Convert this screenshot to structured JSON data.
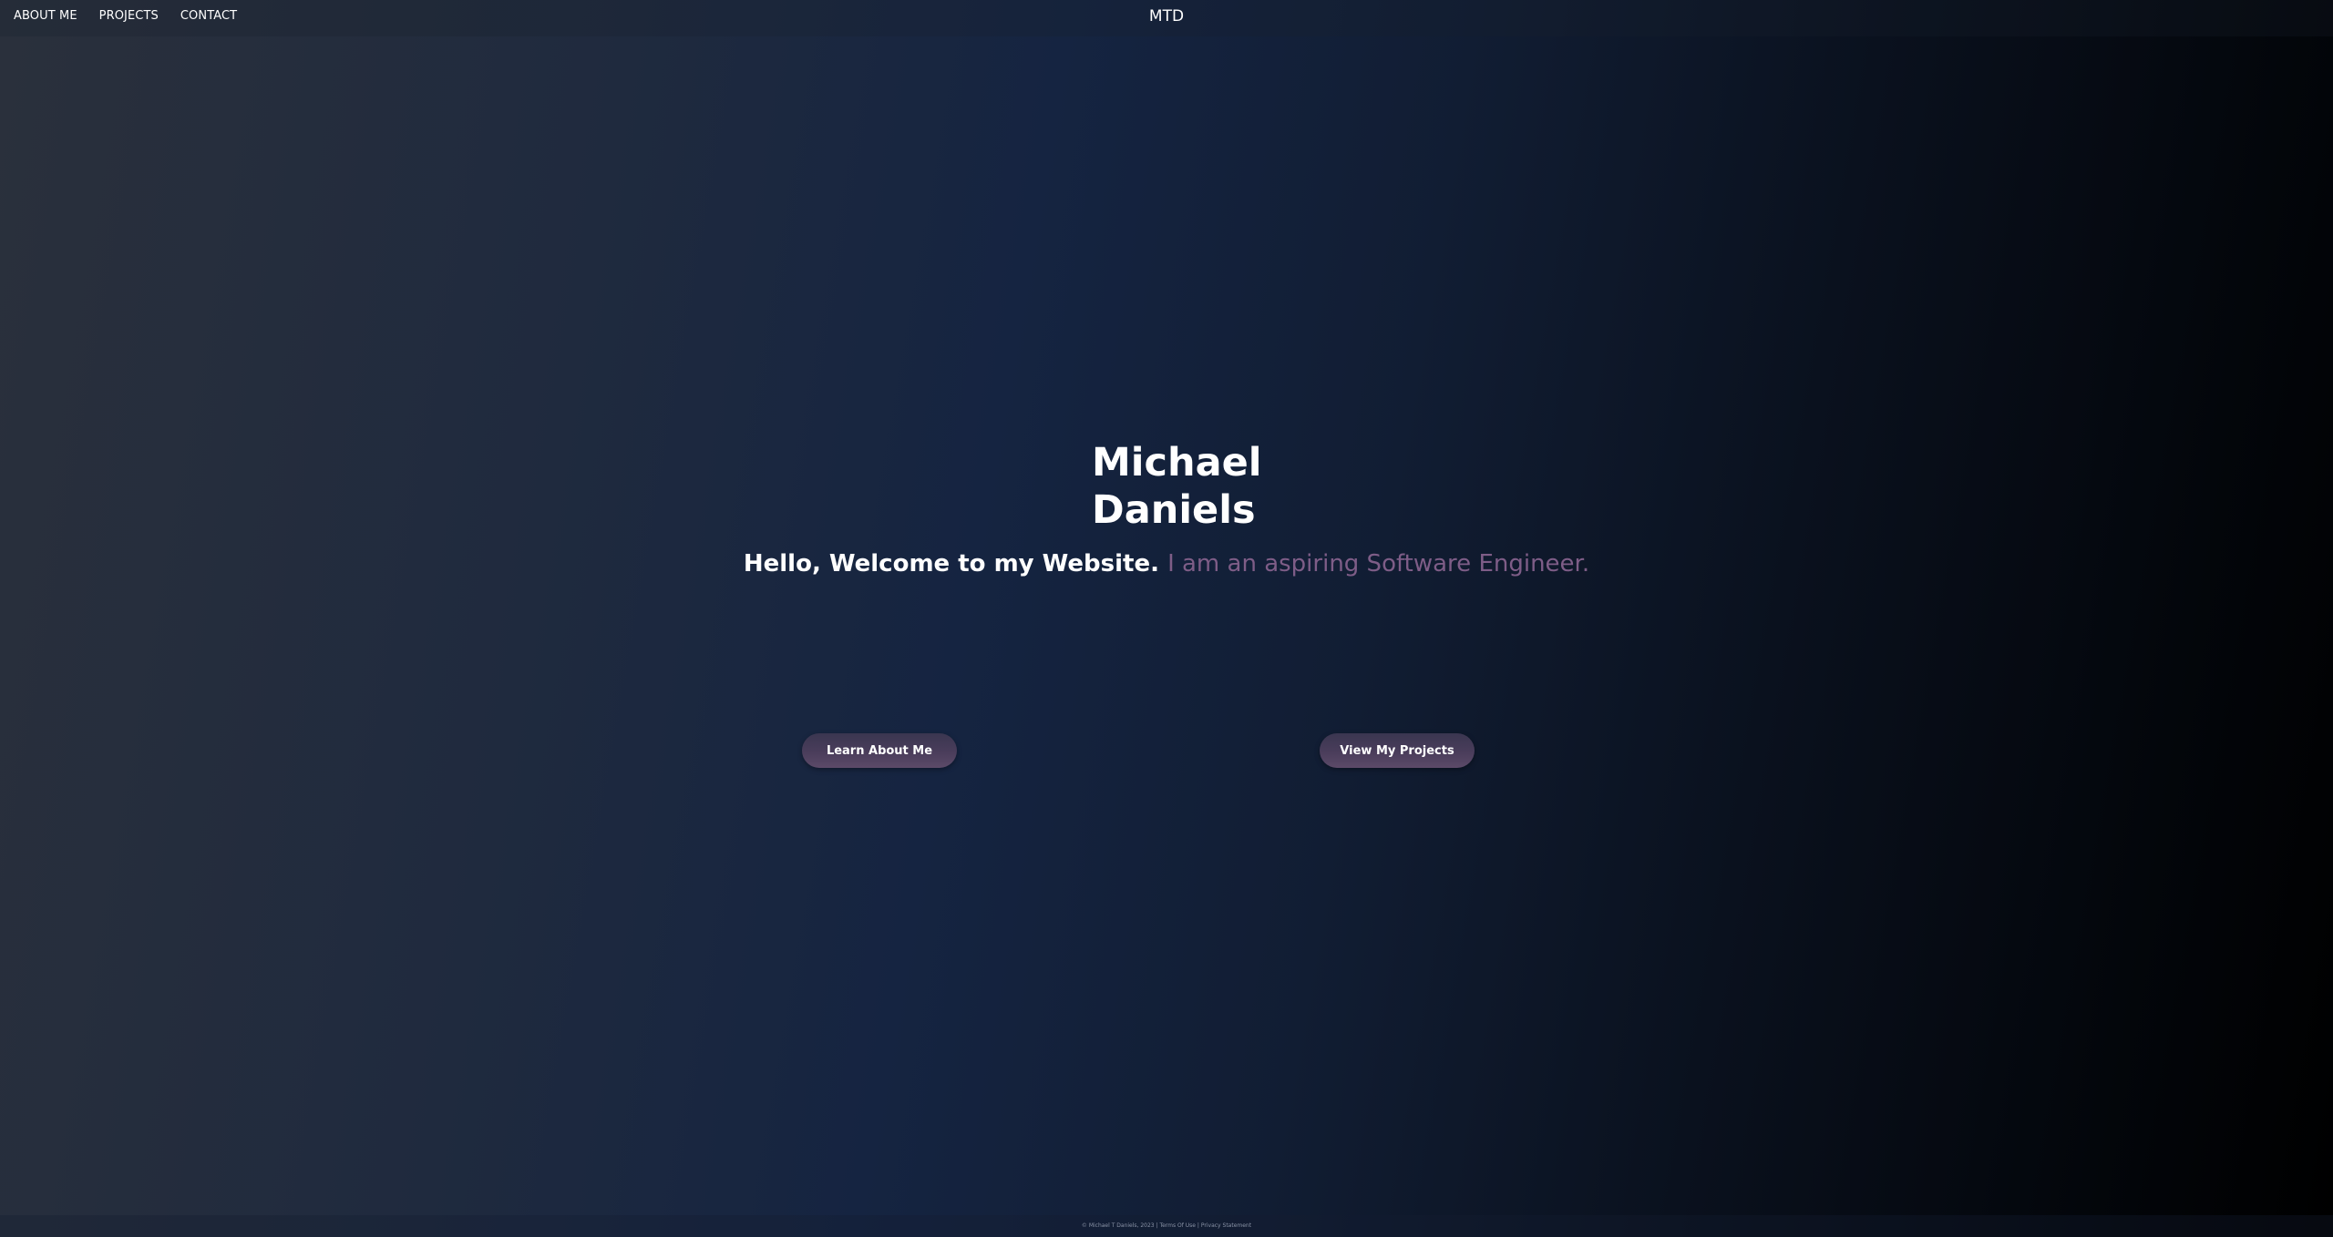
{
  "nav": {
    "links": [
      {
        "label": "ABOUT ME"
      },
      {
        "label": "PROJECTS"
      },
      {
        "label": "CONTACT"
      }
    ],
    "brand": "MTD"
  },
  "hero": {
    "first_name": "Michael",
    "last_name": "Daniels",
    "greeting": "Hello, Welcome to my Website.",
    "role": "I am an aspiring Software Engineer."
  },
  "buttons": {
    "about": "Learn About Me",
    "projects": "View My Projects"
  },
  "footer": {
    "copyright": "© Michael T Daniels, 2023 |",
    "terms": "Terms Of Use",
    "separator": "|",
    "privacy": "Privacy Statement"
  },
  "colors": {
    "accent": "#7e5d87",
    "button": "#4a3d5b",
    "text": "#ffffff"
  }
}
